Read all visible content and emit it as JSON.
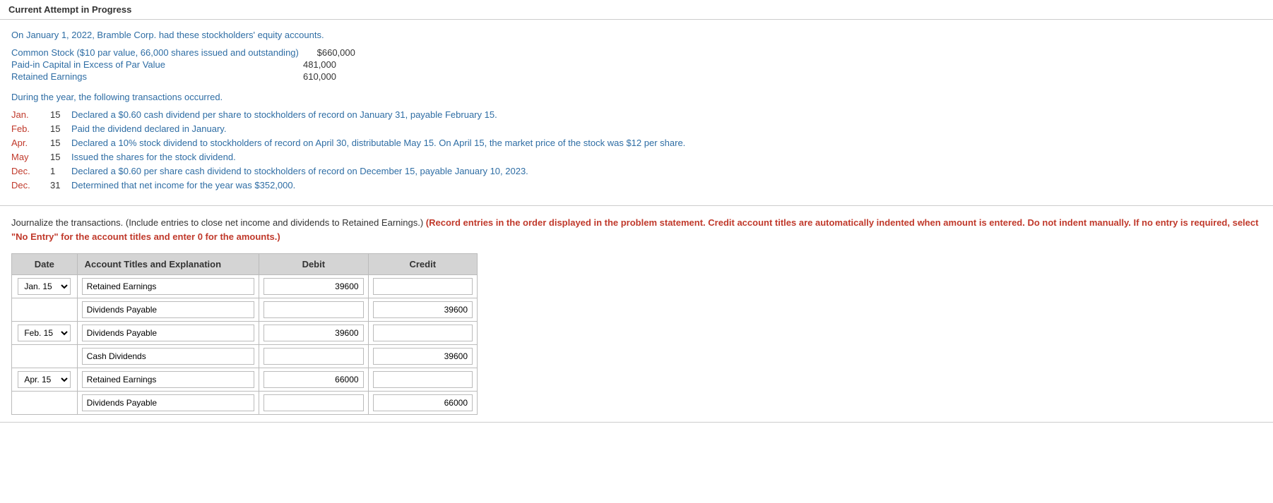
{
  "attempt": {
    "label": "Current Attempt in Progress"
  },
  "problem": {
    "intro": "On January 1, 2022, Bramble Corp. had these stockholders' equity accounts.",
    "equity": [
      {
        "label": "Common Stock ($10 par value, 66,000 shares issued and outstanding)",
        "value": "$660,000"
      },
      {
        "label": "Paid-in Capital in Excess of Par Value",
        "value": "481,000"
      },
      {
        "label": "Retained Earnings",
        "value": "610,000"
      }
    ],
    "during": "During the year, the following transactions occurred.",
    "transactions": [
      {
        "month": "Jan.",
        "day": "15",
        "text": "Declared a $0.60 cash dividend per share to stockholders of record on January 31, payable February 15."
      },
      {
        "month": "Feb.",
        "day": "15",
        "text": "Paid the dividend declared in January."
      },
      {
        "month": "Apr.",
        "day": "15",
        "text": "Declared a 10% stock dividend to stockholders of record on April 30, distributable May 15. On April 15, the market price of the stock was $12 per share."
      },
      {
        "month": "May",
        "day": "15",
        "text": "Issued the shares for the stock dividend."
      },
      {
        "month": "Dec.",
        "day": "1",
        "text": "Declared a $0.60 per share cash dividend to stockholders of record on December 15, payable January 10, 2023."
      },
      {
        "month": "Dec.",
        "day": "31",
        "text": "Determined that net income for the year was $352,000."
      }
    ]
  },
  "instructions": {
    "main": "Journalize the transactions. (Include entries to close net income and dividends to Retained Earnings.)",
    "red": "(Record entries in the order displayed in the problem statement. Credit account titles are automatically indented when amount is entered. Do not indent manually. If no entry is required, select \"No Entry\" for the account titles and enter 0 for the amounts.)"
  },
  "table": {
    "headers": {
      "date": "Date",
      "account": "Account Titles and Explanation",
      "debit": "Debit",
      "credit": "Credit"
    },
    "rows": [
      {
        "date": "Jan. 15",
        "account": "Retained Earnings",
        "debit": "39600",
        "credit": ""
      },
      {
        "date": "",
        "account": "Dividends Payable",
        "debit": "",
        "credit": "39600"
      },
      {
        "date": "Feb. 15",
        "account": "Dividends Payable",
        "debit": "39600",
        "credit": ""
      },
      {
        "date": "",
        "account": "Cash Dividends",
        "debit": "",
        "credit": "39600"
      },
      {
        "date": "Apr. 15",
        "account": "Retained Earnings",
        "debit": "66000",
        "credit": ""
      },
      {
        "date": "",
        "account": "Dividends Payable",
        "debit": "",
        "credit": "66000"
      }
    ]
  }
}
